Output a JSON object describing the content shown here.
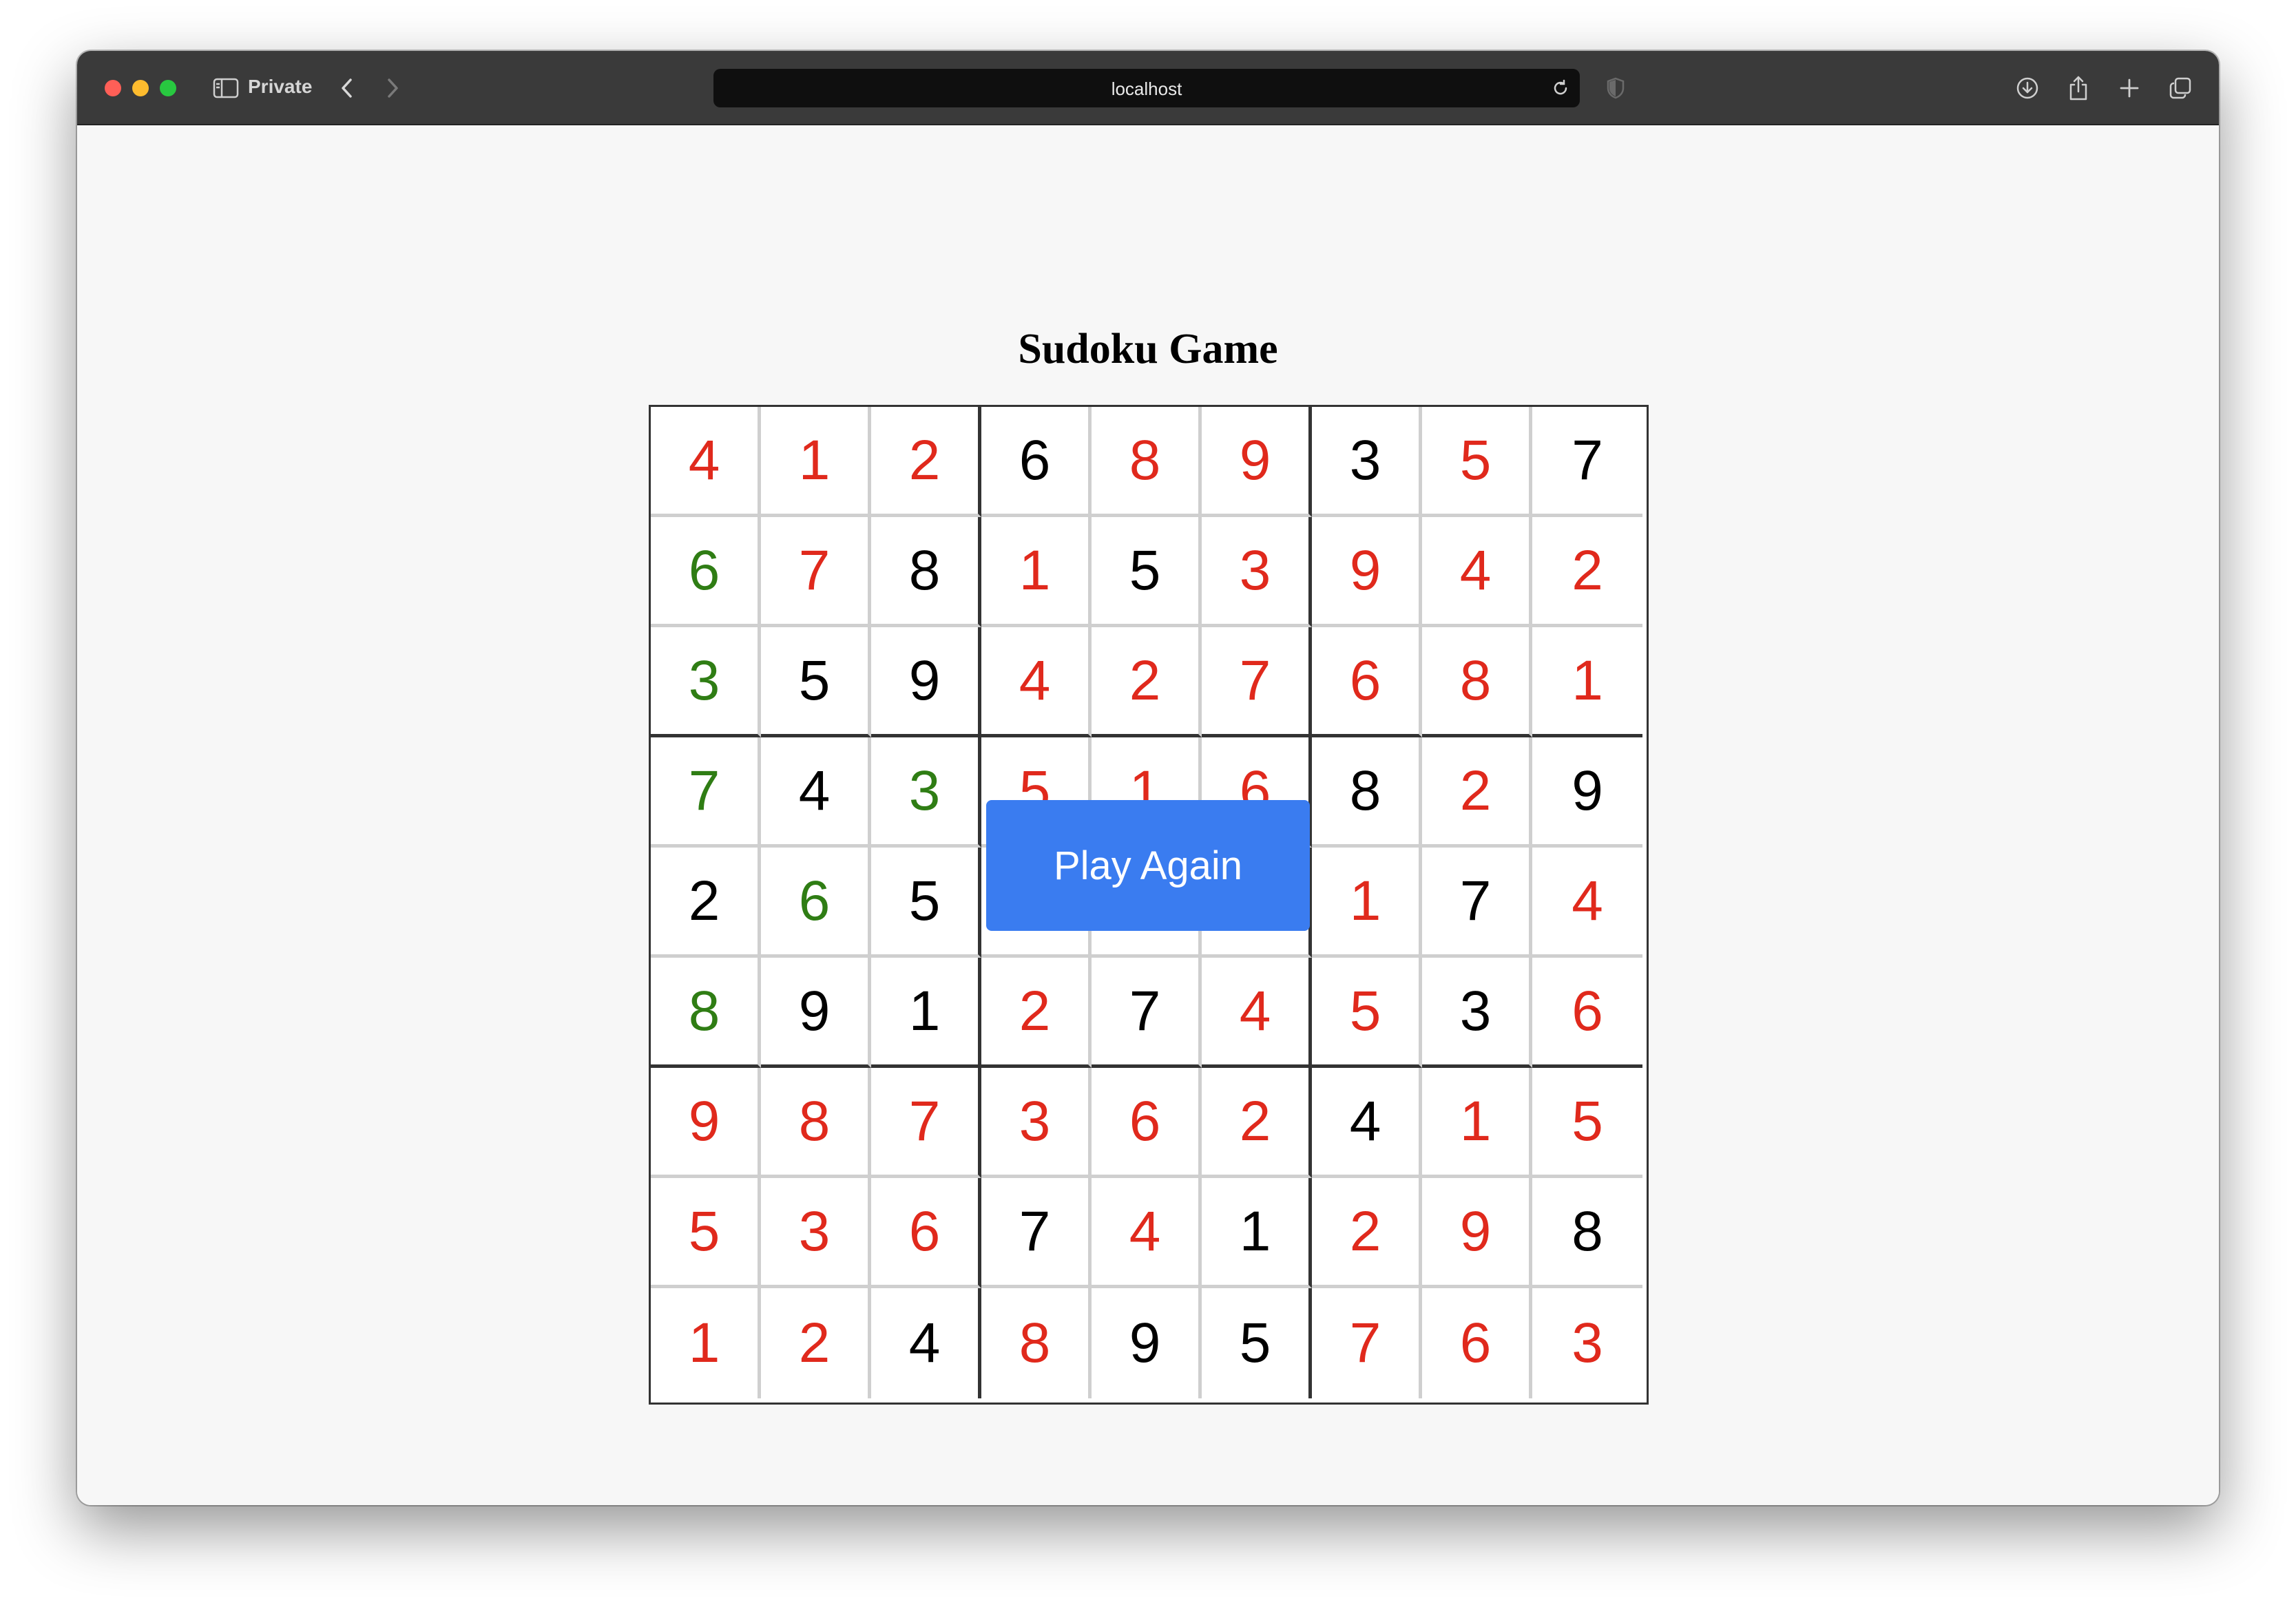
{
  "browser": {
    "mode_label": "Private",
    "url": "localhost"
  },
  "page": {
    "title": "Sudoku Game",
    "play_again_label": "Play Again"
  },
  "board": {
    "values": [
      [
        "4",
        "1",
        "2",
        "6",
        "8",
        "9",
        "3",
        "5",
        "7"
      ],
      [
        "6",
        "7",
        "8",
        "1",
        "5",
        "3",
        "9",
        "4",
        "2"
      ],
      [
        "3",
        "5",
        "9",
        "4",
        "2",
        "7",
        "6",
        "8",
        "1"
      ],
      [
        "7",
        "4",
        "3",
        "5",
        "1",
        "6",
        "8",
        "2",
        "9"
      ],
      [
        "2",
        "6",
        "5",
        "",
        "",
        "",
        "1",
        "7",
        "4"
      ],
      [
        "8",
        "9",
        "1",
        "2",
        "7",
        "4",
        "5",
        "3",
        "6"
      ],
      [
        "9",
        "8",
        "7",
        "3",
        "6",
        "2",
        "4",
        "1",
        "5"
      ],
      [
        "5",
        "3",
        "6",
        "7",
        "4",
        "1",
        "2",
        "9",
        "8"
      ],
      [
        "1",
        "2",
        "4",
        "8",
        "9",
        "5",
        "7",
        "6",
        "3"
      ]
    ],
    "states": [
      [
        "wrong",
        "wrong",
        "wrong",
        "fixed",
        "wrong",
        "wrong",
        "fixed",
        "wrong",
        "fixed"
      ],
      [
        "correct",
        "wrong",
        "fixed",
        "wrong",
        "fixed",
        "wrong",
        "wrong",
        "wrong",
        "wrong"
      ],
      [
        "correct",
        "fixed",
        "fixed",
        "wrong",
        "wrong",
        "wrong",
        "wrong",
        "wrong",
        "wrong"
      ],
      [
        "correct",
        "fixed",
        "correct",
        "wrong",
        "wrong",
        "wrong",
        "fixed",
        "wrong",
        "fixed"
      ],
      [
        "fixed",
        "correct",
        "fixed",
        "fixed",
        "fixed",
        "fixed",
        "wrong",
        "fixed",
        "wrong"
      ],
      [
        "correct",
        "fixed",
        "fixed",
        "wrong",
        "fixed",
        "wrong",
        "wrong",
        "fixed",
        "wrong"
      ],
      [
        "wrong",
        "wrong",
        "wrong",
        "wrong",
        "wrong",
        "wrong",
        "fixed",
        "wrong",
        "wrong"
      ],
      [
        "wrong",
        "wrong",
        "wrong",
        "fixed",
        "wrong",
        "fixed",
        "wrong",
        "wrong",
        "fixed"
      ],
      [
        "wrong",
        "wrong",
        "fixed",
        "wrong",
        "fixed",
        "fixed",
        "wrong",
        "wrong",
        "wrong"
      ]
    ]
  },
  "colors": {
    "fixed": "#000000",
    "wrong": "#e0291c",
    "correct": "#2f7d14",
    "button": "#3a7cf0"
  }
}
